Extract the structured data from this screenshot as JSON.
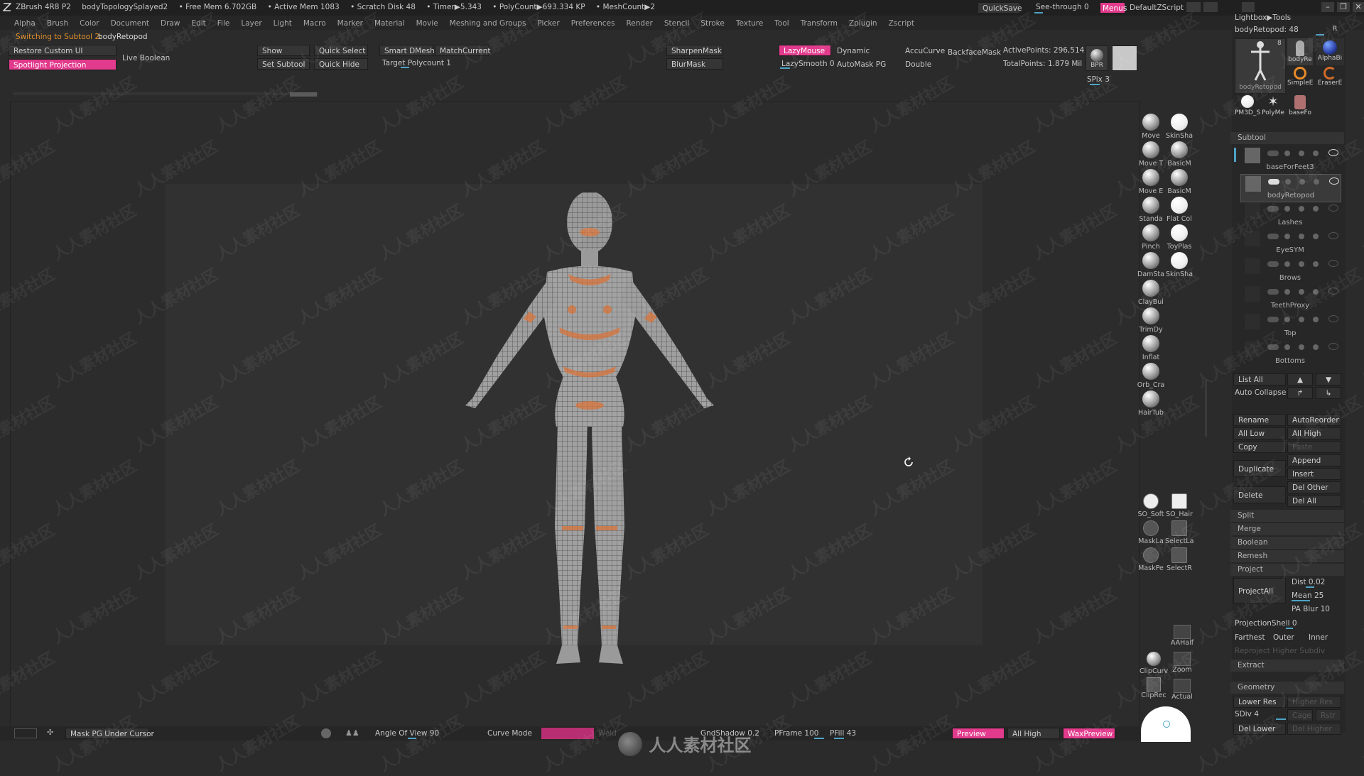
{
  "titlebar": {
    "app": "ZBrush 4R8 P2",
    "doc": "bodyTopologySplayed2",
    "free_mem": "• Free Mem 6.702GB",
    "active_mem": "• Active Mem 1083",
    "scratch": "• Scratch Disk 48",
    "timer": "• Timer▶5.343",
    "polycount": "• PolyCount▶693.334 KP",
    "meshcount": "• MeshCount▶2",
    "quicksave": "QuickSave",
    "see_through": "See-through 0",
    "menus": "Menus",
    "default_zscript": "DefaultZScript"
  },
  "menubar": [
    "Alpha",
    "Brush",
    "Color",
    "Document",
    "Draw",
    "Edit",
    "File",
    "Layer",
    "Light",
    "Macro",
    "Marker",
    "Material",
    "Movie",
    "Meshing and Groups",
    "Picker",
    "Preferences",
    "Render",
    "Stencil",
    "Stroke",
    "Texture",
    "Tool",
    "Transform",
    "Zplugin",
    "Zscript"
  ],
  "status": {
    "prefix": "Switching to Subtool 2:",
    "name": "bodyRetopod"
  },
  "shelf": {
    "restore_custom_ui": "Restore Custom UI",
    "spotlight_projection": "Spotlight Projection",
    "live_boolean": "Live Boolean",
    "show": "Show",
    "set_subtool": "Set Subtool",
    "quick_select": "Quick Select",
    "quick_hide": "Quick Hide",
    "smart_dmesh": "Smart DMesh",
    "match_current": "MatchCurrent",
    "target_polycount": "Target Polycount 1",
    "sharpen_mask": "SharpenMask",
    "blur_mask": "BlurMask",
    "lazy_mouse": "LazyMouse",
    "lazy_smooth": "LazySmooth 0",
    "dynamic": "Dynamic",
    "automask_pg": "AutoMask PG",
    "accucurve": "AccuCurve",
    "double": "Double",
    "backface_mask": "BackfaceMask",
    "active_points": "ActivePoints: 296,514",
    "total_points": "TotalPoints: 1.879 Mil",
    "bpr": "BPR",
    "spix": "SPix 3"
  },
  "brushes": [
    {
      "name": "Move",
      "white": false
    },
    {
      "name": "SkinSha",
      "white": true
    },
    {
      "name": "Move T",
      "white": false
    },
    {
      "name": "BasicM",
      "white": false
    },
    {
      "name": "Move E",
      "white": false
    },
    {
      "name": "BasicM",
      "white": false
    },
    {
      "name": "Standa",
      "white": false
    },
    {
      "name": "Flat Col",
      "white": true
    },
    {
      "name": "Pinch",
      "white": false
    },
    {
      "name": "ToyPlas",
      "white": true
    },
    {
      "name": "DamSta",
      "white": false
    },
    {
      "name": "SkinSha",
      "white": true
    },
    {
      "name": "ClayBui",
      "white": false
    },
    {
      "name": "",
      "white": false
    },
    {
      "name": "TrimDy",
      "white": false
    },
    {
      "name": "",
      "white": false
    },
    {
      "name": "Inflat",
      "white": false
    },
    {
      "name": "",
      "white": false
    },
    {
      "name": "Orb_Cra",
      "white": false
    },
    {
      "name": "",
      "white": false
    },
    {
      "name": "HairTub",
      "white": false
    },
    {
      "name": "",
      "white": false
    }
  ],
  "tools_lower": [
    {
      "name": "SO_Soft"
    },
    {
      "name": "SO_Hair"
    },
    {
      "name": "MaskLa"
    },
    {
      "name": "SelectLa"
    },
    {
      "name": "MaskPe"
    },
    {
      "name": "SelectR"
    }
  ],
  "nav": [
    "AAHalf",
    "Zoom",
    "Actual"
  ],
  "clip": [
    "ClipCurv",
    "ClipRec"
  ],
  "lightbox": {
    "header": "Lightbox▶Tools",
    "current": "bodyRetopod: 48",
    "r_label": "R",
    "tools": [
      "bodyRetopod",
      "bodyRe",
      "AlphaBi",
      "SimpleE",
      "EraserE",
      "PM3D_S",
      "PolyMe",
      "baseFo"
    ],
    "count": "8"
  },
  "subtool": {
    "title": "Subtool",
    "items": [
      "baseForFeet3",
      "bodyRetopod",
      "Lashes",
      "EyeSYM",
      "Brows",
      "TeethProxy",
      "Top",
      "Bottoms"
    ],
    "list_all": "List All",
    "auto_collapse": "Auto Collapse",
    "rename": "Rename",
    "autoreorder": "AutoReorder",
    "all_low": "All Low",
    "all_high": "All High",
    "copy": "Copy",
    "paste": "Paste",
    "append": "Append",
    "duplicate": "Duplicate",
    "insert": "Insert",
    "delete": "Delete",
    "del_other": "Del Other",
    "del_all": "Del All",
    "split": "Split",
    "merge": "Merge",
    "boolean": "Boolean",
    "remesh": "Remesh",
    "project": "Project",
    "project_all": "ProjectAll",
    "dist": "Dist 0.02",
    "mean": "Mean 25",
    "pa_blur": "PA Blur 10",
    "projection_shell": "ProjectionShell 0",
    "farthest": "Farthest",
    "outer": "Outer",
    "inner": "Inner",
    "reproject": "Reproject Higher Subdiv",
    "extract": "Extract"
  },
  "geometry": {
    "title": "Geometry",
    "lower_res": "Lower Res",
    "higher_res": "Higher Res",
    "sdiv": "SDiv 4",
    "cage": "Cage",
    "rstr": "Rstr",
    "del_lower": "Del Lower",
    "del_higher": "Del Higher"
  },
  "bottom": {
    "mask_pg": "Mask PG Under Cursor",
    "angle_of_view": "Angle Of View 90",
    "curve_mode": "Curve Mode",
    "weld": "Weld",
    "gnd_shadow": "GndShadow 0.2",
    "pframe": "PFrame 100",
    "pfill": "PFill 43",
    "preview": "Preview",
    "all_high": "All High",
    "wax_preview": "WaxPreview"
  },
  "watermark": "人人素材社区",
  "colors": {
    "accent": "#e23a8c",
    "slider": "#4da3c4",
    "mesh": "#8a8a8a",
    "polygroup": "#d9743a"
  }
}
